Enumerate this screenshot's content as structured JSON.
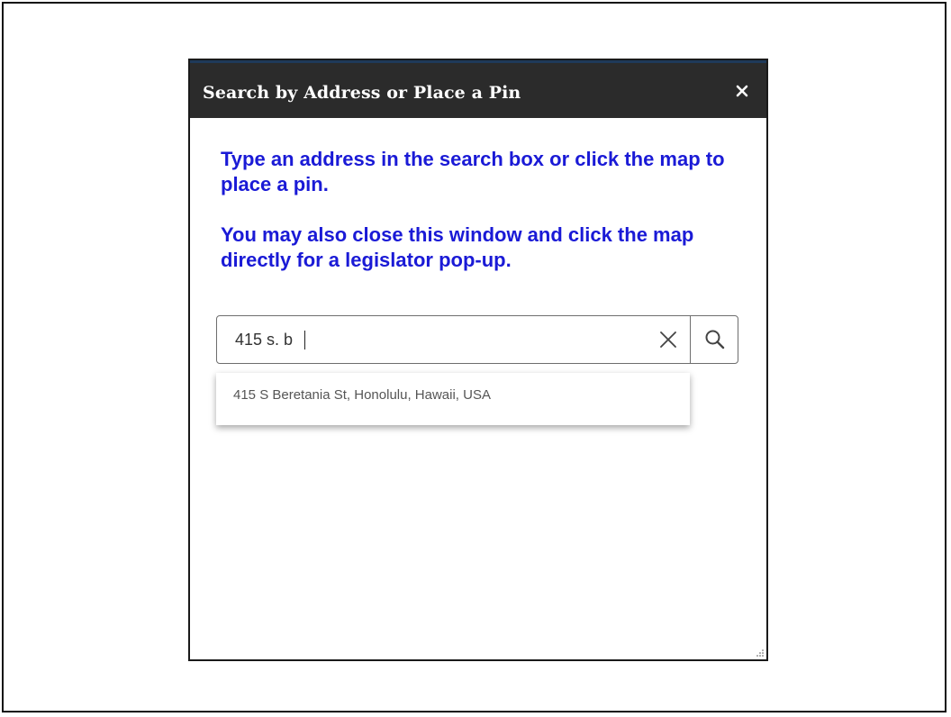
{
  "dialog": {
    "title": "Search by Address or Place a Pin",
    "close_icon": "close-icon",
    "header_color": "#2b2b2b"
  },
  "instructions": {
    "paragraph1": "Type an address in the search box or click the map to place a pin.",
    "paragraph2": "You may also close this window and click the map directly for a legislator pop-up.",
    "text_color": "#1a1ad6"
  },
  "search": {
    "value": "415 s. b",
    "clear_icon": "clear-x-icon",
    "search_icon": "magnifier-icon"
  },
  "suggestions": [
    {
      "label": "415 S Beretania St, Honolulu, Hawaii, USA"
    }
  ]
}
